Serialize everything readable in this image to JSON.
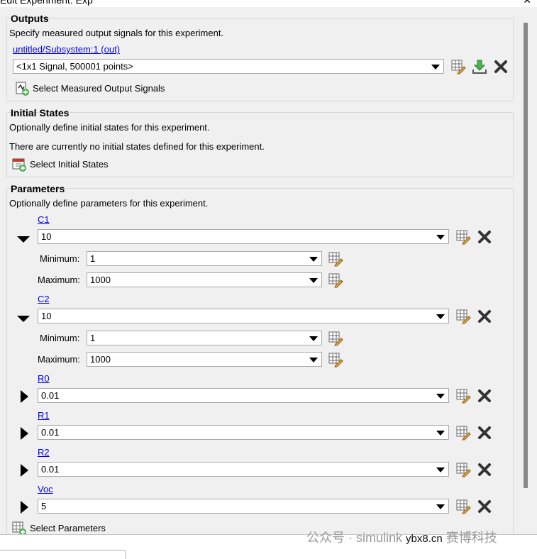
{
  "window": {
    "title": "Edit Experiment: Exp",
    "close_glyph": "✕"
  },
  "outputs": {
    "heading": "Outputs",
    "description": "Specify measured output signals for this experiment.",
    "signal_link": "untitled/Subsystem:1 (out)",
    "signal_value": "<1x1 Signal, 500001 points>",
    "select_button": "Select Measured Output Signals"
  },
  "initial_states": {
    "heading": "Initial States",
    "description": "Optionally define initial states for this experiment.",
    "none_message": "There are currently no initial states defined for this experiment.",
    "select_button": "Select Initial States"
  },
  "parameters": {
    "heading": "Parameters",
    "description": "Optionally define parameters for this experiment.",
    "minimum_label": "Minimum:",
    "maximum_label": "Maximum:",
    "items": [
      {
        "name": "C1",
        "value": "10",
        "expanded": true,
        "minimum": "1",
        "maximum": "1000"
      },
      {
        "name": "C2",
        "value": "10",
        "expanded": true,
        "minimum": "1",
        "maximum": "1000"
      },
      {
        "name": "R0",
        "value": "0.01",
        "expanded": false
      },
      {
        "name": "R1",
        "value": "0.01",
        "expanded": false
      },
      {
        "name": "R2",
        "value": "0.01",
        "expanded": false
      },
      {
        "name": "Voc",
        "value": "5",
        "expanded": false
      }
    ],
    "select_button": "Select Parameters"
  },
  "watermark": {
    "text": "公众号 · simulink",
    "overlay": "ybx8.cn",
    "suffix": "赛博科技"
  },
  "colors": {
    "panel": "#f0f0f0",
    "link": "#0000ee",
    "border": "#d6d6d6"
  }
}
